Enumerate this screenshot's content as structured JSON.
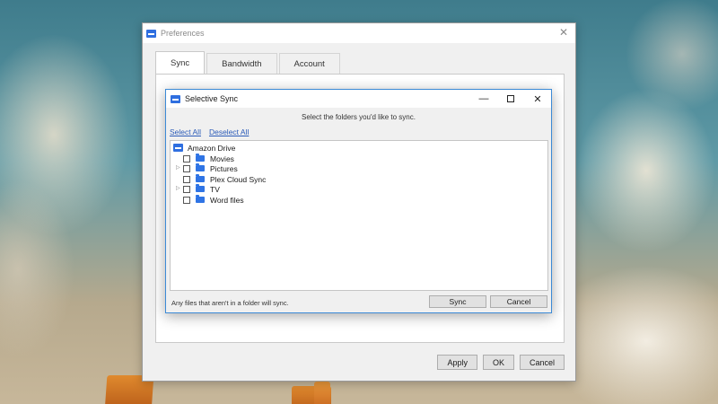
{
  "preferences": {
    "title": "Preferences",
    "close_glyph": "✕",
    "tabs": [
      {
        "label": "Sync",
        "active": true
      },
      {
        "label": "Bandwidth",
        "active": false
      },
      {
        "label": "Account",
        "active": false
      }
    ],
    "buttons": {
      "apply": "Apply",
      "ok": "OK",
      "cancel": "Cancel"
    }
  },
  "selective_sync": {
    "title": "Selective Sync",
    "minimize_glyph": "—",
    "close_glyph": "✕",
    "instruction": "Select the folders you'd like to sync.",
    "select_all": "Select All",
    "deselect_all": "Deselect All",
    "root": "Amazon Drive",
    "folders": [
      {
        "name": "Movies",
        "expandable": false,
        "checked": false
      },
      {
        "name": "Pictures",
        "expandable": true,
        "checked": false
      },
      {
        "name": "Plex Cloud Sync",
        "expandable": false,
        "checked": false
      },
      {
        "name": "TV",
        "expandable": true,
        "checked": false
      },
      {
        "name": "Word files",
        "expandable": false,
        "checked": false
      }
    ],
    "expander_glyph": "▷",
    "footnote": "Any files that aren't in a folder will sync.",
    "buttons": {
      "sync": "Sync",
      "cancel": "Cancel"
    }
  },
  "icons": {
    "app": "amazon-drive-icon",
    "folder": "folder-icon",
    "accent": "#2f74e5"
  }
}
